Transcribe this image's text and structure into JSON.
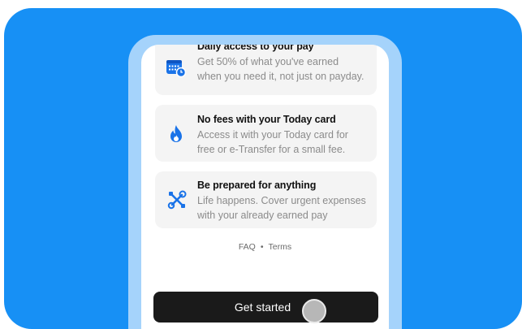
{
  "features": [
    {
      "title": "Daily access to your pay",
      "desc_line1": "Get 50% of what you've earned",
      "desc_line2": "when you need it, not just on payday.",
      "icon": "calendar-clock-icon"
    },
    {
      "title": "No fees with your Today card",
      "desc_line1": "Access it with your Today card for",
      "desc_line2": "free or e-Transfer for a small fee.",
      "icon": "flame-icon"
    },
    {
      "title": "Be prepared for anything",
      "desc_line1": "Life happens. Cover urgent expenses",
      "desc_line2": "with your already earned pay",
      "icon": "tools-icon"
    }
  ],
  "footer": {
    "faq": "FAQ",
    "separator": "•",
    "terms": "Terms"
  },
  "cta": {
    "label": "Get started"
  },
  "colors": {
    "background": "#1790f5",
    "frame": "#a5d3fb",
    "icon_blue": "#1a73e8",
    "button": "#1a1a1a"
  }
}
